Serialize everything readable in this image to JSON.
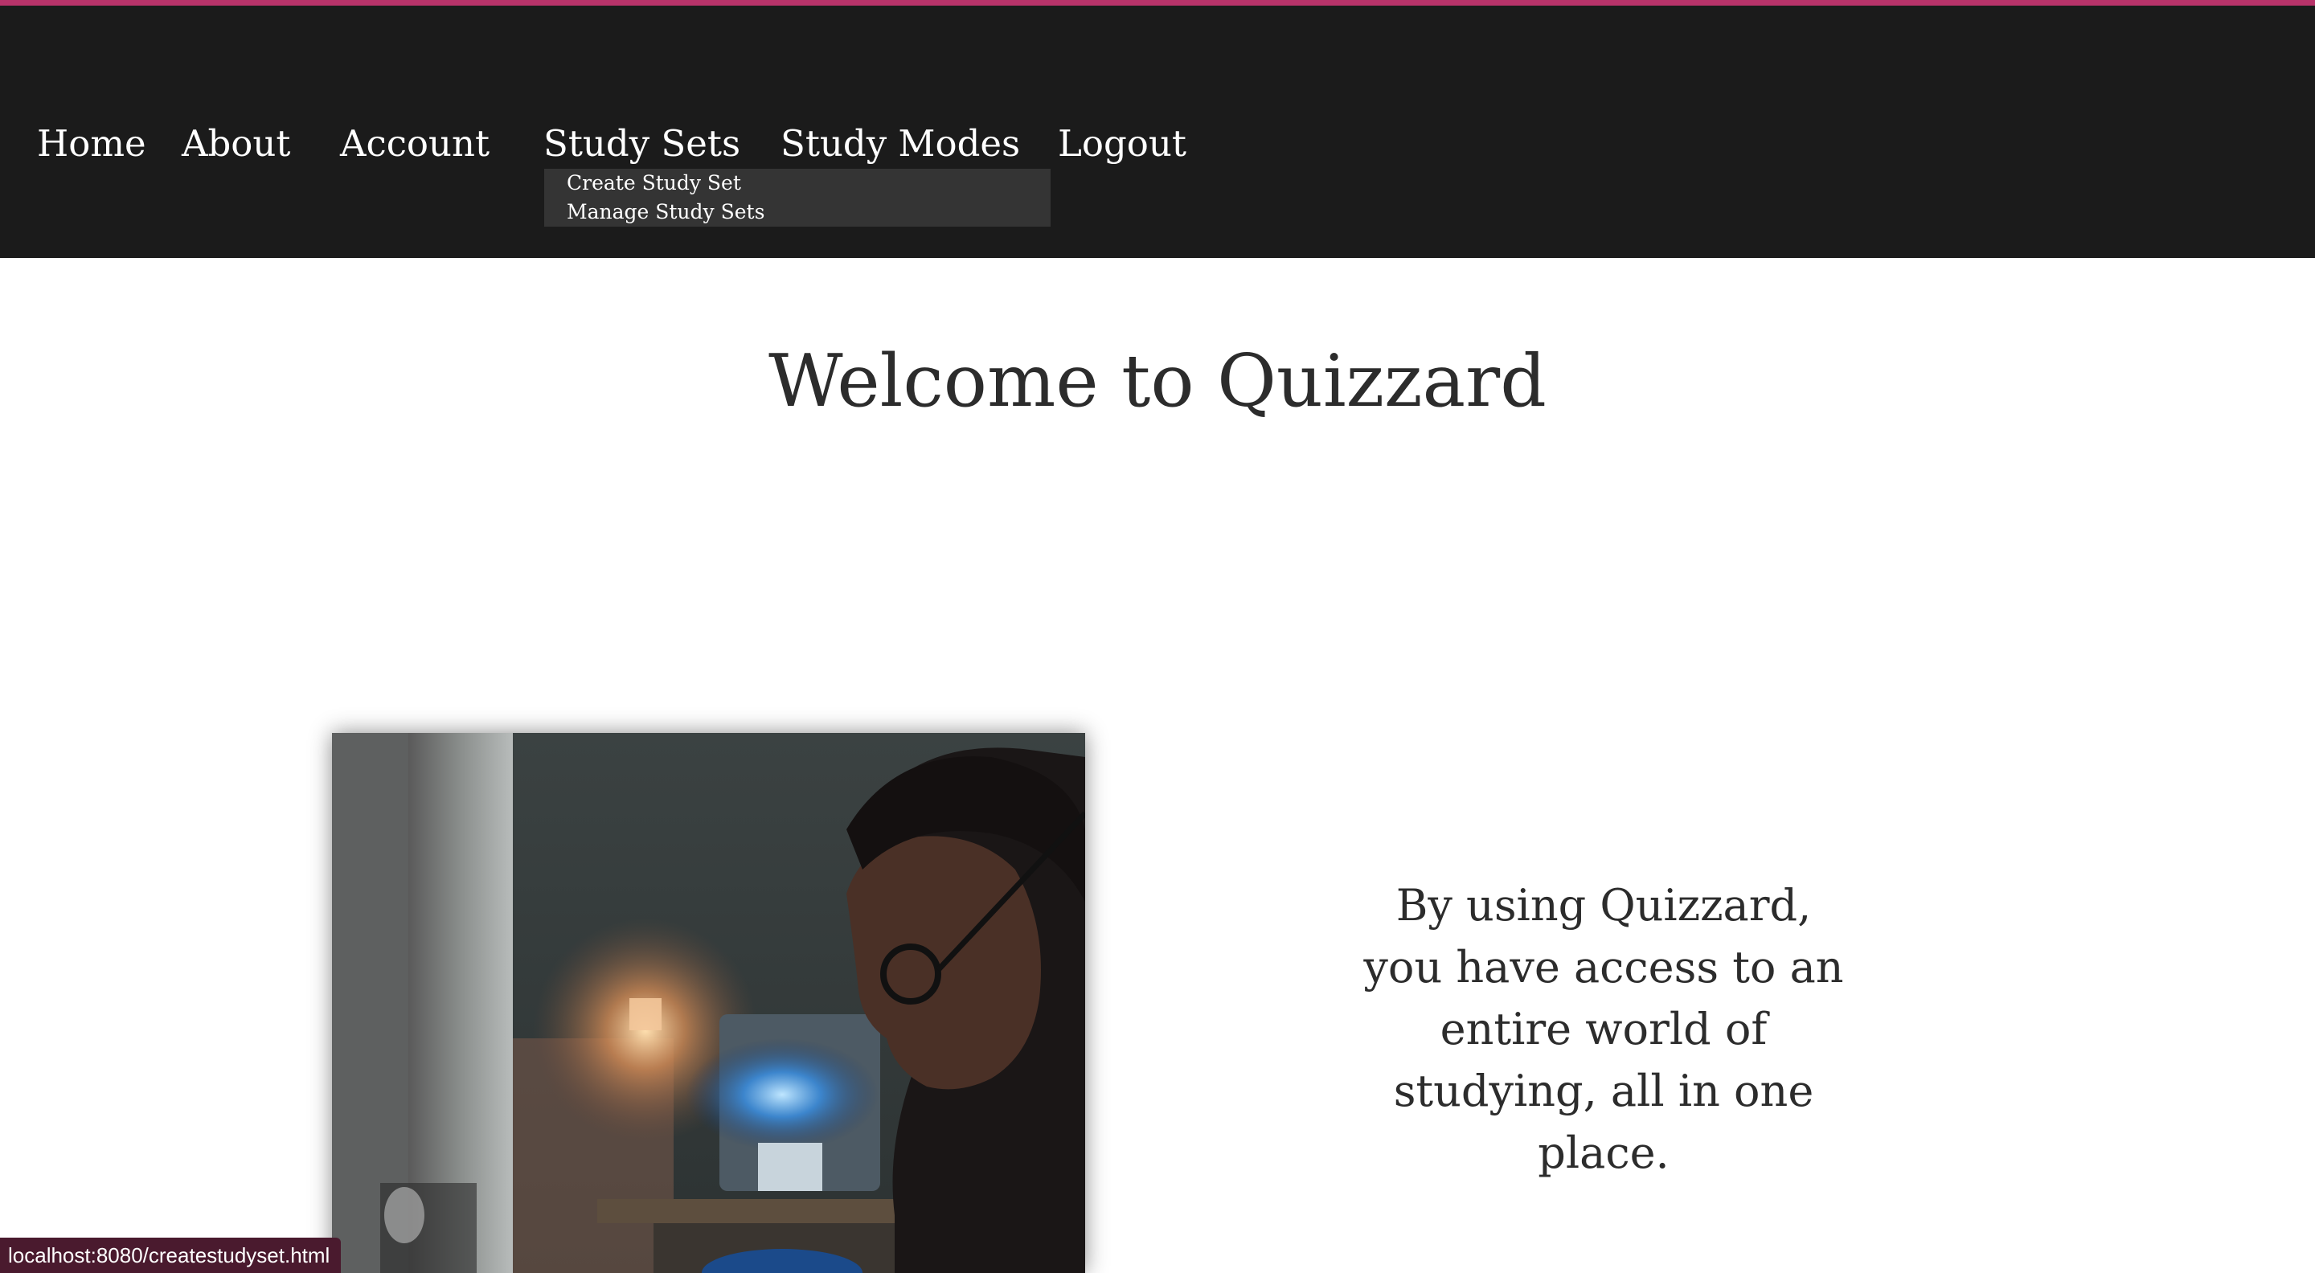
{
  "nav": {
    "items": [
      {
        "label": "Home"
      },
      {
        "label": "About"
      },
      {
        "label": "Account"
      },
      {
        "label": "Study Sets"
      },
      {
        "label": "Study Modes"
      },
      {
        "label": "Logout"
      }
    ],
    "dropdown": {
      "items": [
        {
          "label": "Create Study Set"
        },
        {
          "label": "Manage Study Sets"
        }
      ]
    }
  },
  "main": {
    "title": "Welcome to Quizzard",
    "tagline": "By using Quizzard, you have access to an entire world of studying, all in one place."
  },
  "status_bar": {
    "url": "localhost:8080/createstudyset.html"
  },
  "colors": {
    "accent": "#b8336a",
    "navbar_bg": "#1b1b1b",
    "dropdown_bg": "#343434",
    "status_bg": "#4a1a2e"
  }
}
